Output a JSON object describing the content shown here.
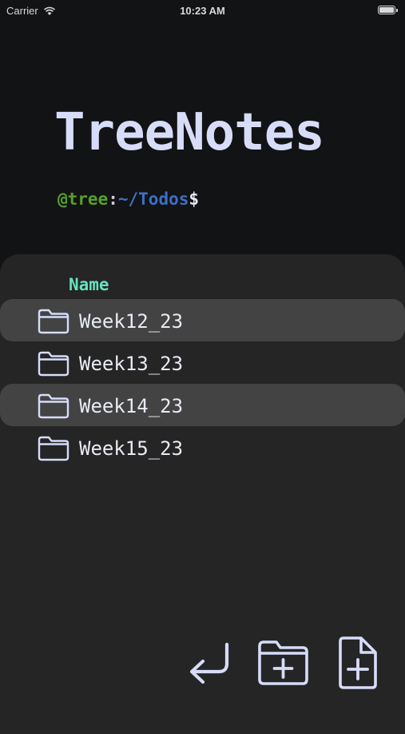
{
  "status_bar": {
    "carrier": "Carrier",
    "time": "10:23 AM",
    "battery_level": 1.0
  },
  "app": {
    "title": "TreeNotes"
  },
  "prompt": {
    "user": "@tree",
    "separator": ":",
    "path": "~/Todos",
    "symbol": "$"
  },
  "file_browser": {
    "column_header": "Name",
    "items": [
      {
        "label": "Week12_23",
        "icon": "folder-icon",
        "highlighted": true
      },
      {
        "label": "Week13_23",
        "icon": "folder-icon",
        "highlighted": false
      },
      {
        "label": "Week14_23",
        "icon": "folder-icon",
        "highlighted": true
      },
      {
        "label": "Week15_23",
        "icon": "folder-icon",
        "highlighted": false
      }
    ]
  },
  "toolbar": {
    "buttons": [
      {
        "icon": "return-arrow-icon"
      },
      {
        "icon": "new-folder-icon"
      },
      {
        "icon": "new-file-icon"
      }
    ]
  },
  "colors": {
    "background": "#121314",
    "panel": "#252526",
    "row_highlight": "#434344",
    "title": "#d7dcf8",
    "prompt_user": "#56a12a",
    "prompt_path": "#3c6fc7",
    "column_header": "#66e2bd",
    "icon_stroke": "#d7dcf8"
  }
}
